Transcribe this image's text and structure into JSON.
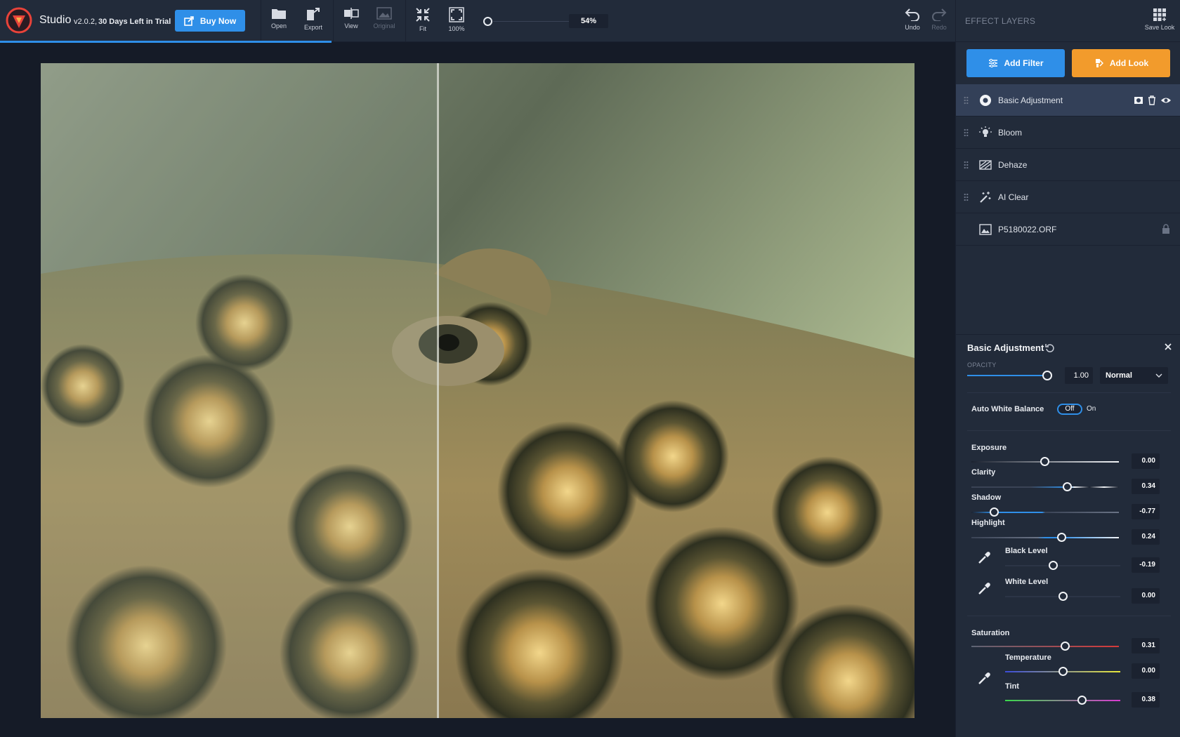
{
  "toolbar": {
    "app_name": "Studio",
    "version": "v2.0.2,",
    "trial": "30 Days Left in Trial",
    "buy_label": "Buy Now",
    "open_label": "Open",
    "export_label": "Export",
    "view_label": "View",
    "original_label": "Original",
    "fit_label": "Fit",
    "zoom100_label": "100%",
    "zoom_value": "54%",
    "undo_label": "Undo",
    "redo_label": "Redo",
    "progress_fraction": 0.28,
    "accent_color": "#2f8fe8"
  },
  "canvas": {
    "view_mode": "split-before-after"
  },
  "panel": {
    "title": "EFFECT LAYERS",
    "save_look_label": "Save Look",
    "add_filter_label": "Add Filter",
    "add_look_label": "Add Look",
    "add_look_color": "#f29b2c",
    "layers": [
      {
        "label": "Basic Adjustment",
        "icon": "aperture-icon",
        "active": true
      },
      {
        "label": "Bloom",
        "icon": "bulb-icon",
        "active": false
      },
      {
        "label": "Dehaze",
        "icon": "dehaze-icon",
        "active": false
      },
      {
        "label": "AI Clear",
        "icon": "magic-wand-icon",
        "active": false
      },
      {
        "label": "P5180022.ORF",
        "icon": "image-icon",
        "active": false,
        "locked": true
      }
    ]
  },
  "adjust": {
    "title": "Basic Adjustment",
    "opacity_label": "OPACITY",
    "opacity_value": "1.00",
    "opacity_level": 1.0,
    "blend_mode": "Normal",
    "awb_label": "Auto White Balance",
    "awb_off": "Off",
    "awb_on": "On",
    "awb_state": "Off",
    "exposure": {
      "label": "Exposure",
      "value": "0.00",
      "level": 0.5
    },
    "clarity": {
      "label": "Clarity",
      "value": "0.34",
      "level": 0.65
    },
    "shadow": {
      "label": "Shadow",
      "value": "-0.77",
      "level": 0.15
    },
    "highlight": {
      "label": "Highlight",
      "value": "0.24",
      "level": 0.61
    },
    "black_level": {
      "label": "Black Level",
      "value": "-0.19",
      "level": 0.4
    },
    "white_level": {
      "label": "White Level",
      "value": "0.00",
      "level": 0.5
    },
    "saturation": {
      "label": "Saturation",
      "value": "0.31",
      "level": 0.64
    },
    "temperature": {
      "label": "Temperature",
      "value": "0.00",
      "level": 0.5
    },
    "tint": {
      "label": "Tint",
      "value": "0.38",
      "level": 0.66
    }
  }
}
